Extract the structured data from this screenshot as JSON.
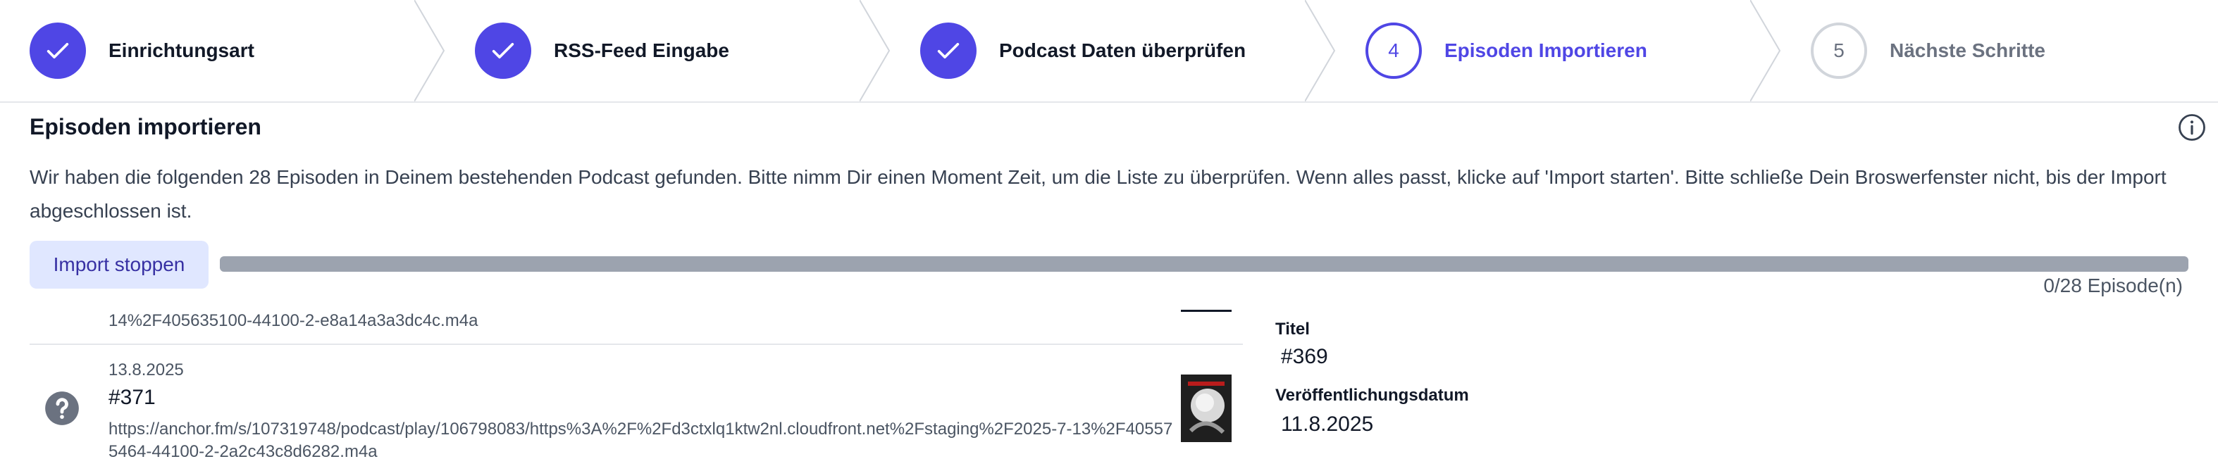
{
  "stepper": {
    "steps": [
      {
        "label": "Einrichtungsart",
        "state": "done",
        "icon": "check-icon"
      },
      {
        "label": "RSS-Feed Eingabe",
        "state": "done",
        "icon": "check-icon"
      },
      {
        "label": "Podcast Daten überprüfen",
        "state": "done",
        "icon": "check-icon"
      },
      {
        "number": "4",
        "label": "Episoden Importieren",
        "state": "current"
      },
      {
        "number": "5",
        "label": "Nächste Schritte",
        "state": "upcoming"
      }
    ]
  },
  "page": {
    "title": "Episoden importieren",
    "info_icon": "info-icon",
    "description": "Wir haben die folgenden 28 Episoden in Deinem bestehenden Podcast gefunden. Bitte nimm Dir einen Moment Zeit, um die Liste zu überprüfen. Wenn alles passt, klicke auf 'Import starten'. Bitte schließe Dein Broswerfenster nicht, bis der Import abgeschlossen ist."
  },
  "import": {
    "stop_label": "Import stoppen",
    "progress_fraction": 0,
    "progress_text": "0/28 Episode(n)"
  },
  "episodes": {
    "prev_url_tail": "14%2F405635100-44100-2-e8a14a3a3dc4c.m4a",
    "current": {
      "date": "13.8.2025",
      "title": "#371",
      "url": "https://anchor.fm/s/107319748/podcast/play/106798083/https%3A%2F%2Fd3ctxlq1ktw2nl.cloudfront.net%2Fstaging%2F2025-7-13%2F405575464-44100-2-2a2c43c8d6282.m4a",
      "status_icon": "question-icon"
    }
  },
  "detail": {
    "title_label": "Titel",
    "title_value": "#369",
    "date_label": "Veröffentlichungsdatum",
    "date_value": "11.8.2025"
  },
  "colors": {
    "accent": "#4f46e5",
    "progress_track": "#9ca3af",
    "button_bg": "#e0e7ff"
  }
}
